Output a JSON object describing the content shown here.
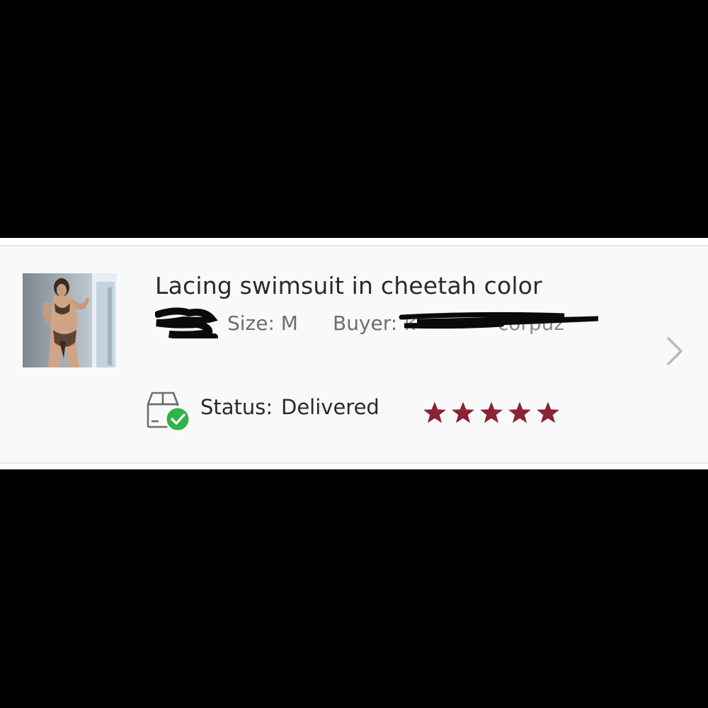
{
  "order": {
    "title": "Lacing swimsuit in cheetah color",
    "size_text": "Size: M",
    "buyer_label": "Buyer:",
    "buyer_value": "k•••••••corpuz",
    "status_label": "Status:",
    "status_value": "Delivered",
    "rating": 5,
    "thumbnail_icon": "product-photo",
    "status_icon": "package-delivered-icon",
    "chevron_icon": "chevron-right-icon"
  },
  "colors": {
    "star": "#8b2333",
    "check": "#2fb34a",
    "card_bg": "#faf9fa",
    "text_dark": "#2b2a2b",
    "text_muted": "#6e6d6e"
  }
}
